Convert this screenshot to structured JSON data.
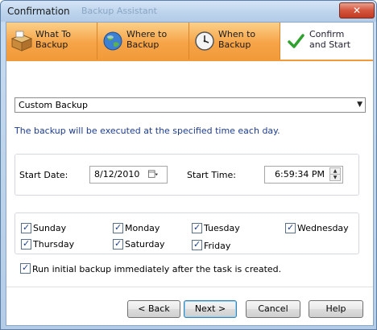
{
  "window": {
    "title": "Confirmation",
    "ghost_title": "Backup Assistant",
    "close_label": "✕"
  },
  "tabs": [
    {
      "label": "What To\nBackup",
      "icon": "box-icon",
      "active": false
    },
    {
      "label": "Where to\nBackup",
      "icon": "globe-icon",
      "active": false
    },
    {
      "label": "When to\nBackup",
      "icon": "clock-icon",
      "active": false
    },
    {
      "label": "Confirm\nand Start",
      "icon": "checkmark-icon",
      "active": true
    }
  ],
  "backup_type": {
    "selected": "Custom Backup"
  },
  "info_text": "The backup will be executed at the specified time each day.",
  "schedule": {
    "start_date_label": "Start Date:",
    "start_date": "8/12/2010",
    "start_time_label": "Start Time:",
    "start_time": "6:59:34 PM"
  },
  "days": [
    {
      "label": "Sunday",
      "checked": true
    },
    {
      "label": "Monday",
      "checked": true
    },
    {
      "label": "Tuesday",
      "checked": true
    },
    {
      "label": "Wednesday",
      "checked": true
    },
    {
      "label": "Thursday",
      "checked": true
    },
    {
      "label": "Saturday",
      "checked": true
    },
    {
      "label": "Friday",
      "checked": true
    }
  ],
  "run_initial": {
    "label": "Run initial backup immediately after the task is created.",
    "checked": true
  },
  "buttons": {
    "back": "< Back",
    "next": "Next >",
    "cancel": "Cancel",
    "help": "Help"
  },
  "colors": {
    "tab_orange": "#f19a3a",
    "info_blue": "#1e3c8c"
  }
}
